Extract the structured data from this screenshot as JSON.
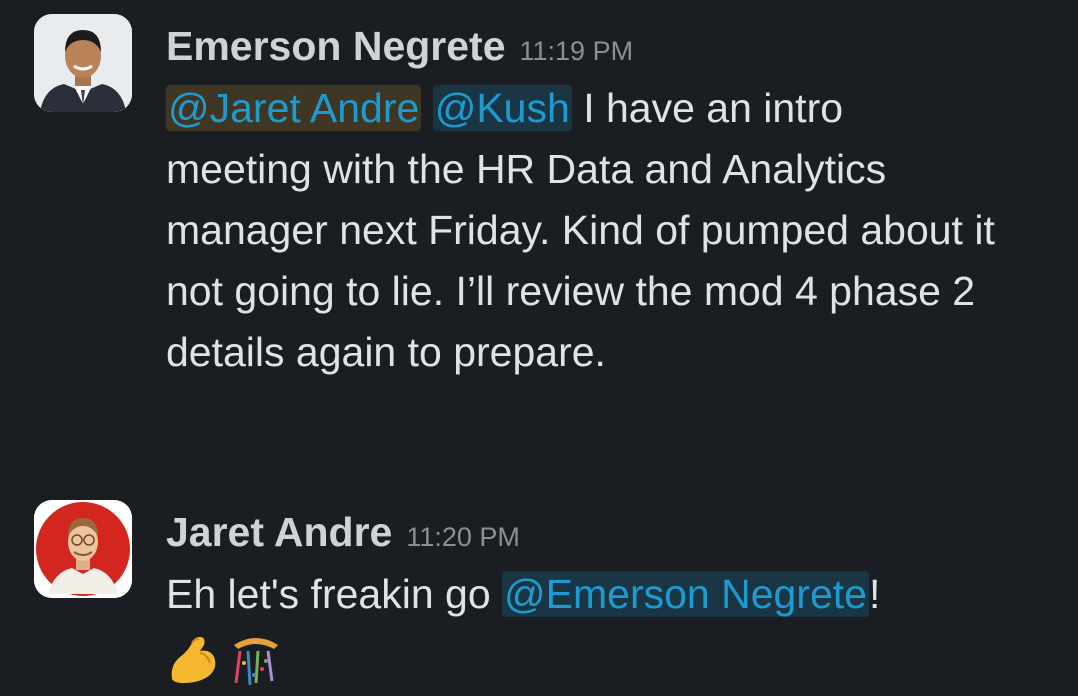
{
  "messages": [
    {
      "author": "Emerson Negrete",
      "timestamp": "11:19 PM",
      "mentions": [
        "@Jaret Andre",
        "@Kush"
      ],
      "text_line1": " I have an intro",
      "text_rest": "meeting with the HR Data and Analytics manager next Friday. Kind of pumped about it not going to lie. I’ll review the mod 4 phase 2 details again to prepare.",
      "avatar_icon": "emerson-avatar"
    },
    {
      "author": "Jaret Andre",
      "timestamp": "11:20 PM",
      "text_before": "Eh let's freakin go ",
      "mention": "@Emerson Negrete",
      "text_after": "!",
      "emojis": [
        "flexed-biceps-icon",
        "confetti-ball-icon"
      ],
      "avatar_icon": "jaret-avatar"
    }
  ],
  "colors": {
    "background": "#1a1d21",
    "mention": "#1d9bd1",
    "timestamp": "#8e8f91"
  }
}
